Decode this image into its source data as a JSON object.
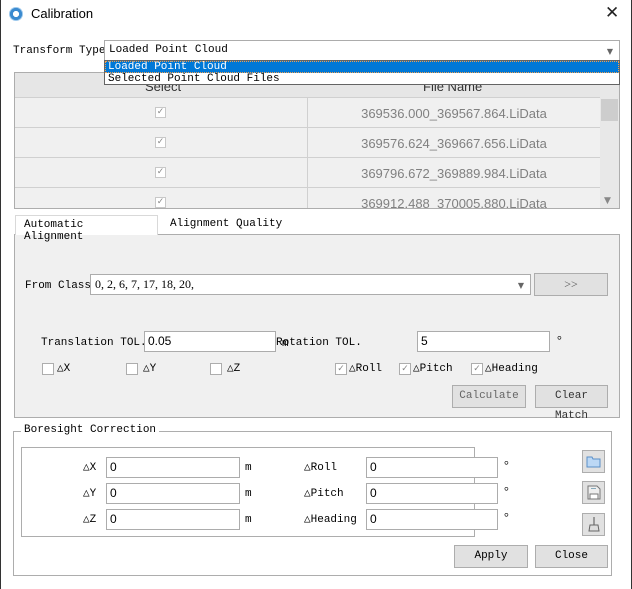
{
  "window": {
    "title": "Calibration",
    "logo": "lidar-logo",
    "close": "✕"
  },
  "transform": {
    "label": "Transform Type",
    "value": "Loaded Point Cloud",
    "options": [
      "Loaded Point Cloud",
      "Selected Point Cloud Files"
    ]
  },
  "table": {
    "columns": [
      "Select",
      "File Name"
    ],
    "rows": [
      {
        "checked": true,
        "file": "369536.000_369567.864.LiData"
      },
      {
        "checked": true,
        "file": "369576.624_369667.656.LiData"
      },
      {
        "checked": true,
        "file": "369796.672_369889.984.LiData"
      },
      {
        "checked": true,
        "file": "369912.488_370005.880.LiData"
      }
    ]
  },
  "tabs": [
    "Automatic Alignment",
    "Alignment Quality"
  ],
  "auto": {
    "from_class_label": "From Class:",
    "from_class_value": "0, 2, 6, 7, 17, 18, 20,",
    "more_button": ">>",
    "translation_label": "Translation TOL.",
    "translation_value": "0.05",
    "translation_unit": "m",
    "rotation_label": "Rotation TOL.",
    "rotation_value": "5",
    "rotation_unit": "°",
    "checks": [
      {
        "label": "△X",
        "checked": false
      },
      {
        "label": "△Y",
        "checked": false
      },
      {
        "label": "△Z",
        "checked": false
      },
      {
        "label": "△Roll",
        "checked": true
      },
      {
        "label": "△Pitch",
        "checked": true
      },
      {
        "label": "△Heading",
        "checked": true
      }
    ],
    "calculate": "Calculate",
    "clear_match": "Clear Match"
  },
  "boresight": {
    "title": "Boresight Correction",
    "fields": [
      {
        "label": "△X",
        "value": "0",
        "unit": "m"
      },
      {
        "label": "△Y",
        "value": "0",
        "unit": "m"
      },
      {
        "label": "△Z",
        "value": "0",
        "unit": "m"
      },
      {
        "label": "△Roll",
        "value": "0",
        "unit": "°"
      },
      {
        "label": "△Pitch",
        "value": "0",
        "unit": "°"
      },
      {
        "label": "△Heading",
        "value": "0",
        "unit": "°"
      }
    ],
    "apply": "Apply",
    "close": "Close"
  }
}
